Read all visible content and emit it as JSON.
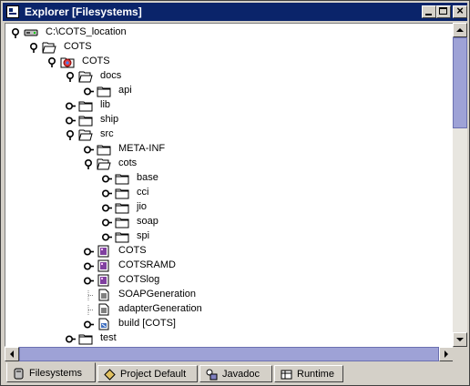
{
  "window": {
    "title": "Explorer [Filesystems]"
  },
  "tree": [
    {
      "label": "C:\\COTS_location",
      "depth": 0,
      "expanded": true,
      "icon": "drive-icon"
    },
    {
      "label": "COTS",
      "depth": 1,
      "expanded": true,
      "icon": "folder-open-icon"
    },
    {
      "label": "COTS",
      "depth": 2,
      "expanded": true,
      "icon": "module-icon"
    },
    {
      "label": "docs",
      "depth": 3,
      "expanded": true,
      "icon": "folder-open-icon"
    },
    {
      "label": "api",
      "depth": 4,
      "expanded": false,
      "icon": "folder-icon"
    },
    {
      "label": "lib",
      "depth": 3,
      "expanded": false,
      "icon": "folder-icon"
    },
    {
      "label": "ship",
      "depth": 3,
      "expanded": false,
      "icon": "folder-icon"
    },
    {
      "label": "src",
      "depth": 3,
      "expanded": true,
      "icon": "folder-open-icon"
    },
    {
      "label": "META-INF",
      "depth": 4,
      "expanded": false,
      "icon": "folder-icon"
    },
    {
      "label": "cots",
      "depth": 4,
      "expanded": true,
      "icon": "folder-open-icon"
    },
    {
      "label": "base",
      "depth": 5,
      "expanded": false,
      "icon": "folder-icon"
    },
    {
      "label": "cci",
      "depth": 5,
      "expanded": false,
      "icon": "folder-icon"
    },
    {
      "label": "jio",
      "depth": 5,
      "expanded": false,
      "icon": "folder-icon"
    },
    {
      "label": "soap",
      "depth": 5,
      "expanded": false,
      "icon": "folder-icon"
    },
    {
      "label": "spi",
      "depth": 5,
      "expanded": false,
      "icon": "folder-icon"
    },
    {
      "label": "COTS",
      "depth": 4,
      "expanded": false,
      "icon": "form-icon"
    },
    {
      "label": "COTSRAMD",
      "depth": 4,
      "expanded": false,
      "icon": "form-icon"
    },
    {
      "label": "COTSlog",
      "depth": 4,
      "expanded": false,
      "icon": "form-icon"
    },
    {
      "label": "SOAPGeneration",
      "depth": 4,
      "expanded": null,
      "icon": "document-icon"
    },
    {
      "label": "adapterGeneration",
      "depth": 4,
      "expanded": null,
      "icon": "document-icon"
    },
    {
      "label": "build [COTS]",
      "depth": 4,
      "expanded": false,
      "icon": "build-icon"
    },
    {
      "label": "test",
      "depth": 3,
      "expanded": false,
      "icon": "folder-icon"
    }
  ],
  "tabs": [
    {
      "label": "Filesystems",
      "icon": "filesystems-icon",
      "active": true
    },
    {
      "label": "Project Default",
      "icon": "project-icon",
      "active": false
    },
    {
      "label": "Javadoc",
      "icon": "javadoc-icon",
      "active": false
    },
    {
      "label": "Runtime",
      "icon": "runtime-icon",
      "active": false
    }
  ],
  "colors": {
    "titlebar": "#0a246a",
    "scroll_thumb": "#9ea2d6",
    "chrome": "#d4d0c8"
  }
}
